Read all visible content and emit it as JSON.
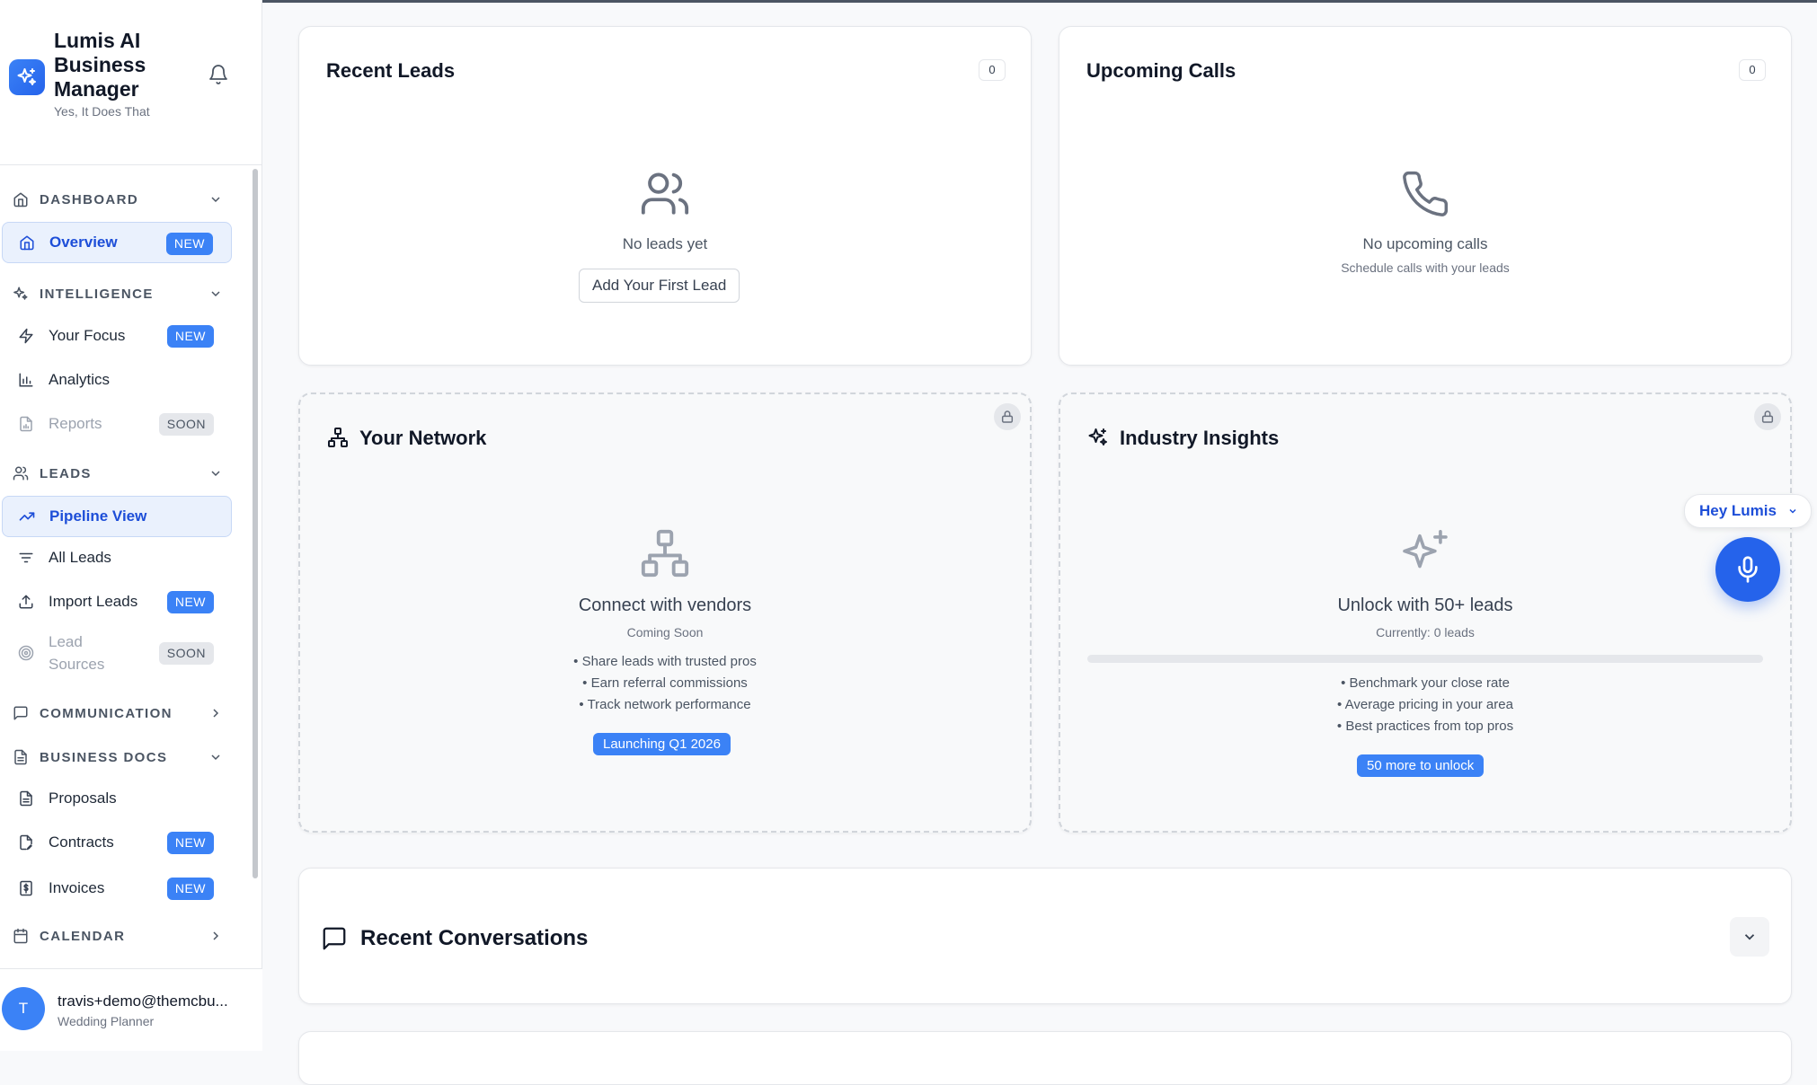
{
  "app": {
    "name": "Lumis AI Business Manager",
    "tagline": "Yes, It Does That"
  },
  "sidebar": {
    "sections": [
      {
        "label": "DASHBOARD",
        "icon": "home-icon"
      },
      {
        "label": "INTELLIGENCE",
        "icon": "sparkles-icon"
      },
      {
        "label": "LEADS",
        "icon": "users-icon"
      },
      {
        "label": "COMMUNICATION",
        "icon": "message-square-icon"
      },
      {
        "label": "BUSINESS DOCS",
        "icon": "file-text-icon"
      },
      {
        "label": "CALENDAR",
        "icon": "calendar-icon"
      }
    ],
    "items": {
      "overview": {
        "label": "Overview",
        "badge": "NEW"
      },
      "your_focus": {
        "label": "Your Focus",
        "badge": "NEW"
      },
      "analytics": {
        "label": "Analytics"
      },
      "reports": {
        "label": "Reports",
        "badge": "SOON"
      },
      "pipeline_view": {
        "label": "Pipeline View"
      },
      "all_leads": {
        "label": "All Leads"
      },
      "import_leads": {
        "label": "Import Leads",
        "badge": "NEW"
      },
      "lead_sources": {
        "label": "Lead Sources",
        "badge": "SOON"
      },
      "proposals": {
        "label": "Proposals"
      },
      "contracts": {
        "label": "Contracts",
        "badge": "NEW"
      },
      "invoices": {
        "label": "Invoices",
        "badge": "NEW"
      }
    }
  },
  "user": {
    "initial": "T",
    "email": "travis+demo@themcbu...",
    "role": "Wedding Planner"
  },
  "recent_leads": {
    "title": "Recent Leads",
    "count": "0",
    "empty_text": "No leads yet",
    "button": "Add Your First Lead"
  },
  "upcoming_calls": {
    "title": "Upcoming Calls",
    "count": "0",
    "empty_text": "No upcoming calls",
    "empty_sub": "Schedule calls with your leads"
  },
  "your_network": {
    "title": "Your Network",
    "feature_title": "Connect with vendors",
    "status": "Coming Soon",
    "bullets": [
      "• Share leads with trusted pros",
      "• Earn referral commissions",
      "• Track network performance"
    ],
    "pill": "Launching Q1 2026"
  },
  "industry_insights": {
    "title": "Industry Insights",
    "feature_title": "Unlock with 50+ leads",
    "status": "Currently: 0 leads",
    "progress": 0,
    "bullets": [
      "• Benchmark your close rate",
      "• Average pricing in your area",
      "• Best practices from top pros"
    ],
    "pill": "50 more to unlock"
  },
  "assistant": {
    "label": "Hey Lumis"
  },
  "recent_conversations": {
    "title": "Recent Conversations"
  },
  "colors": {
    "accent": "#3b82f6",
    "accent_dark": "#1d4ed8"
  }
}
